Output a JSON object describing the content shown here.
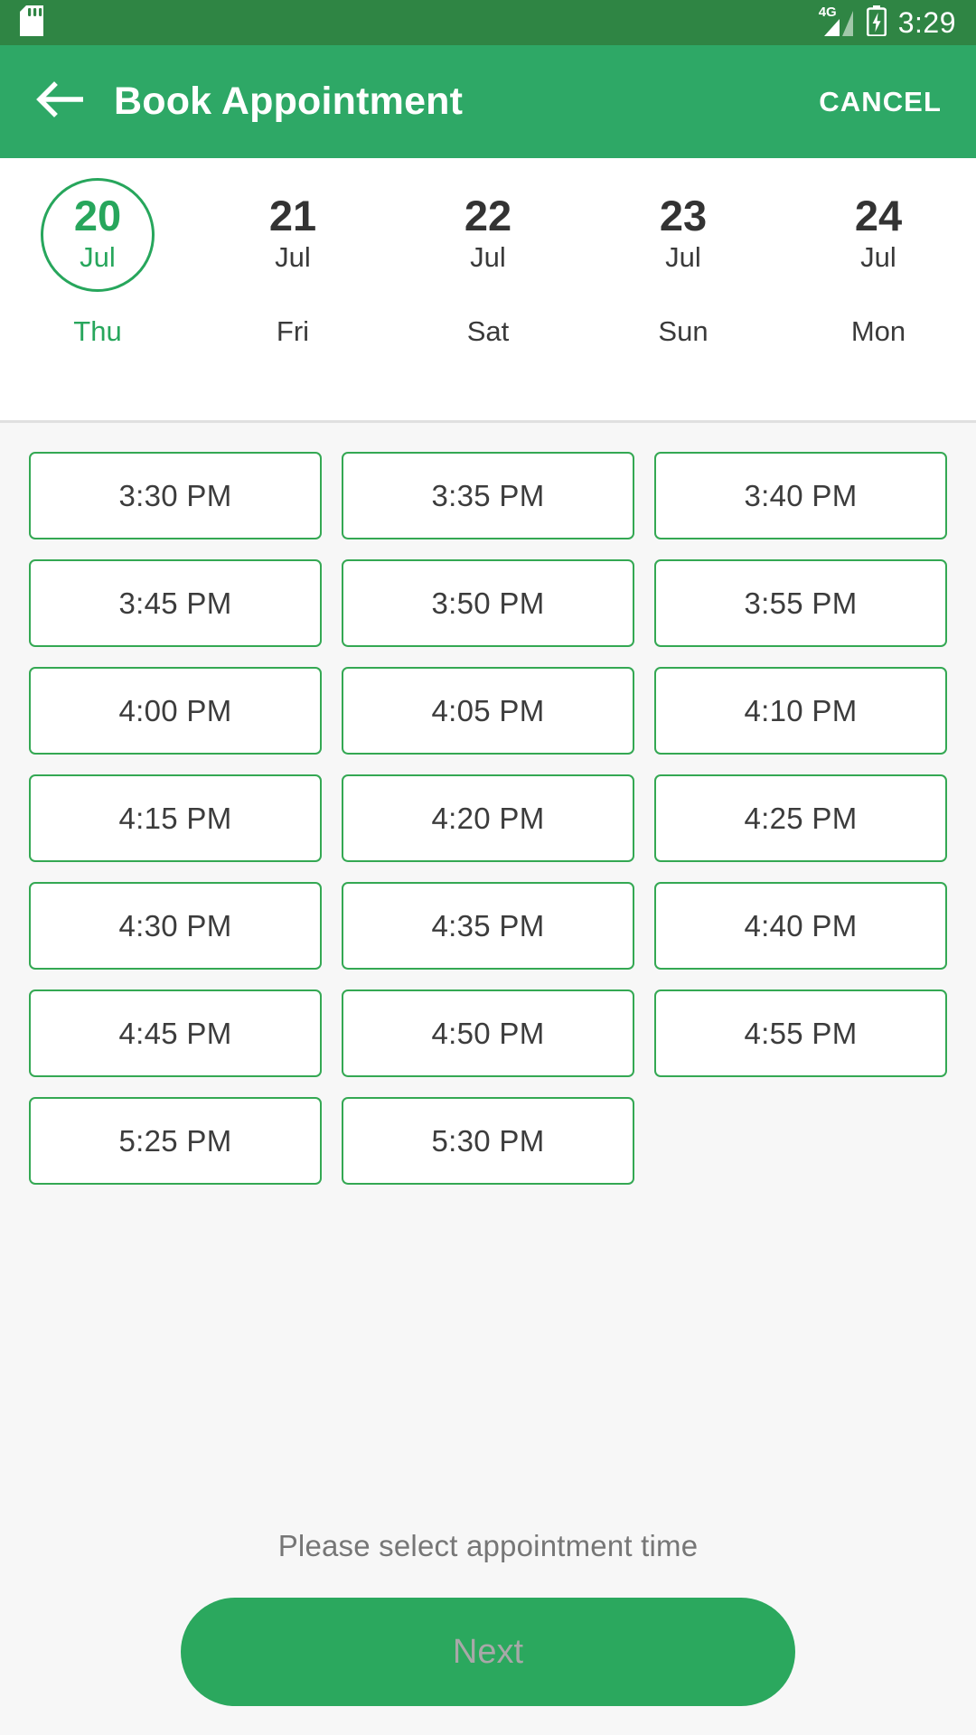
{
  "status_bar": {
    "sd_card_icon": "sd-card-icon",
    "network_label": "4G",
    "signal_icon": "signal-bars-icon",
    "battery_icon": "battery-charging-icon",
    "time": "3:29"
  },
  "app_bar": {
    "back_icon": "back-arrow-icon",
    "title": "Book Appointment",
    "cancel_label": "CANCEL"
  },
  "date_strip": {
    "dates": [
      {
        "day": "20",
        "month": "Jul",
        "weekday": "Thu",
        "selected": true
      },
      {
        "day": "21",
        "month": "Jul",
        "weekday": "Fri",
        "selected": false
      },
      {
        "day": "22",
        "month": "Jul",
        "weekday": "Sat",
        "selected": false
      },
      {
        "day": "23",
        "month": "Jul",
        "weekday": "Sun",
        "selected": false
      },
      {
        "day": "24",
        "month": "Jul",
        "weekday": "Mon",
        "selected": false
      }
    ]
  },
  "time_slots": [
    "3:30 PM",
    "3:35 PM",
    "3:40 PM",
    "3:45 PM",
    "3:50 PM",
    "3:55 PM",
    "4:00 PM",
    "4:05 PM",
    "4:10 PM",
    "4:15 PM",
    "4:20 PM",
    "4:25 PM",
    "4:30 PM",
    "4:35 PM",
    "4:40 PM",
    "4:45 PM",
    "4:50 PM",
    "4:55 PM",
    "5:25 PM",
    "5:30 PM"
  ],
  "footer": {
    "hint": "Please select appointment time",
    "next_label": "Next"
  },
  "colors": {
    "status_bar_green": "#2F8544",
    "app_bar_green": "#2EA866",
    "accent_green": "#27A65C",
    "slot_border_green": "#34A853",
    "next_button_green": "#2BA85E",
    "content_background": "#F7F7F7",
    "disabled_text": "#A8A8A8"
  }
}
